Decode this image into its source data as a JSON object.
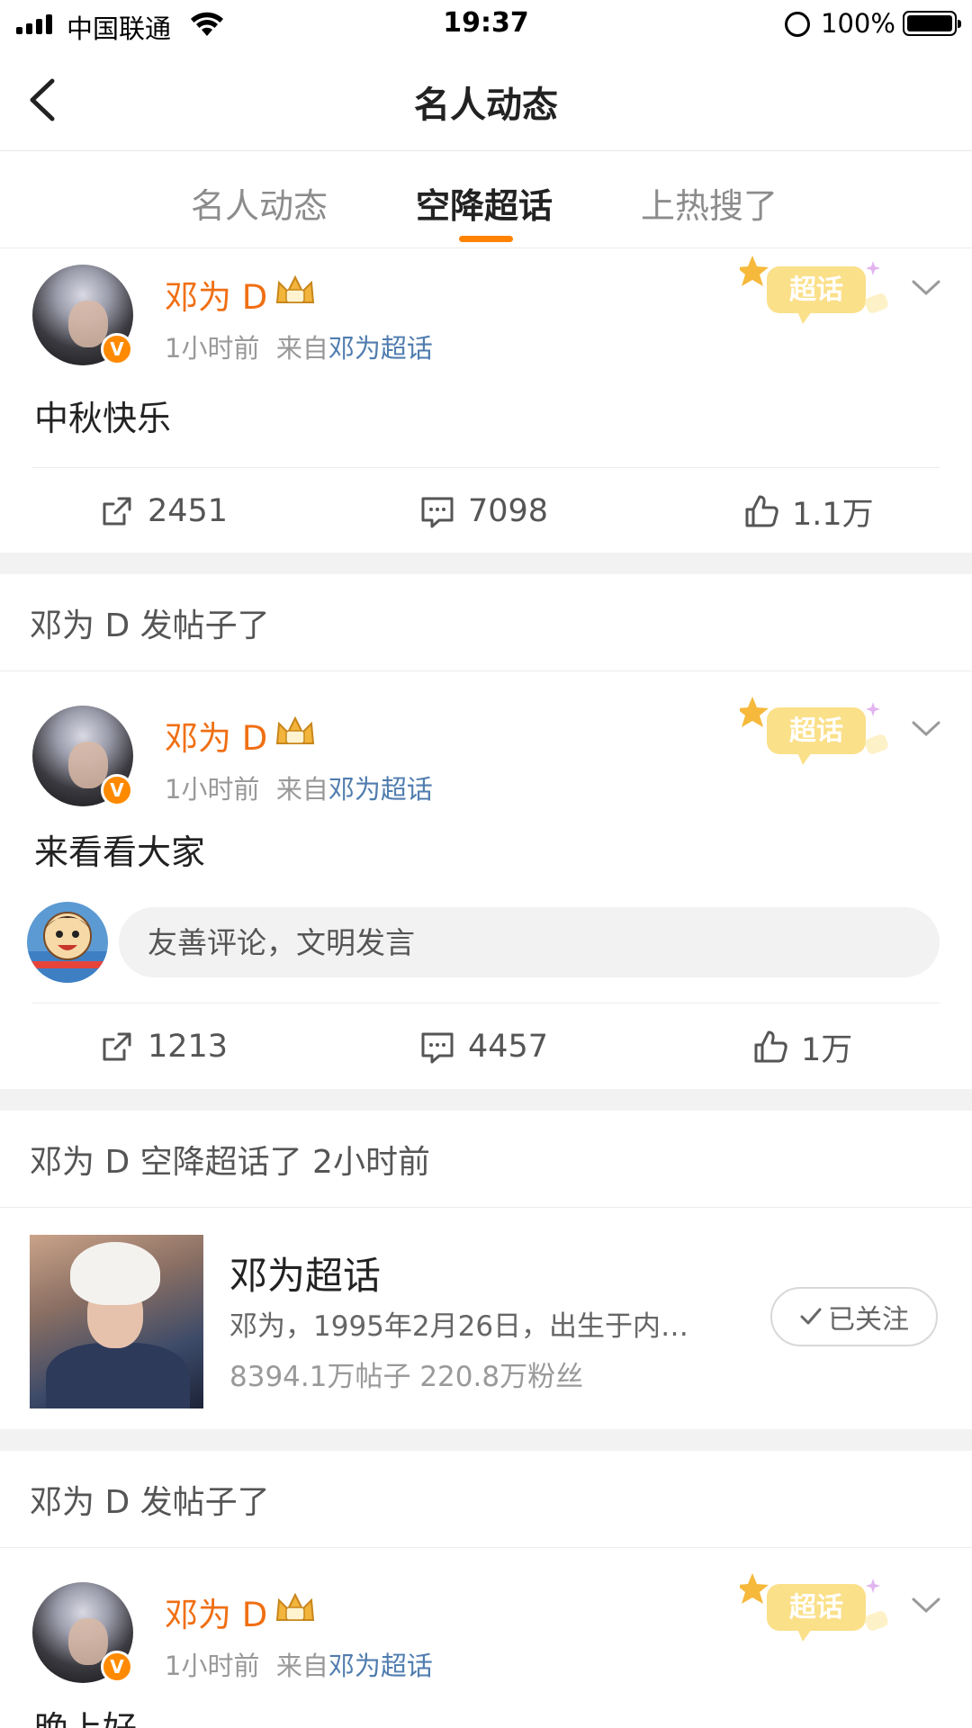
{
  "status_bar": {
    "carrier": "中国联通",
    "time": "19:37",
    "battery_percent": "100%"
  },
  "nav": {
    "title": "名人动态"
  },
  "tabs": [
    {
      "label": "名人动态",
      "active": false
    },
    {
      "label": "空降超话",
      "active": true
    },
    {
      "label": "上热搜了",
      "active": false
    }
  ],
  "colors": {
    "accent": "#ff8200",
    "username": "#f06f14",
    "link": "#507daf"
  },
  "feed": {
    "post1": {
      "user_name": "邓为 D",
      "time": "1小时前",
      "source_prefix": "来自",
      "source_link": "邓为超话",
      "badge": "超话",
      "text": "中秋快乐",
      "reposts": "2451",
      "comments": "7098",
      "likes": "1.1万"
    },
    "section2": {
      "header": "邓为 D 发帖子了"
    },
    "post2": {
      "user_name": "邓为 D",
      "time": "1小时前",
      "source_prefix": "来自",
      "source_link": "邓为超话",
      "badge": "超话",
      "text": "来看看大家",
      "comment_placeholder": "友善评论，文明发言",
      "reposts": "1213",
      "comments": "4457",
      "likes": "1万"
    },
    "section3": {
      "header": "邓为 D 空降超话了 2小时前"
    },
    "topic": {
      "title": "邓为超话",
      "description": "邓为，1995年2月26日，出生于内…",
      "stats": "8394.1万帖子  220.8万粉丝",
      "follow_label": "已关注"
    },
    "section4": {
      "header": "邓为 D 发帖子了"
    },
    "post3": {
      "user_name": "邓为 D",
      "time": "1小时前",
      "source_prefix": "来自",
      "source_link": "邓为超话",
      "badge": "超话",
      "text": "晚上好"
    }
  },
  "icons": [
    "signal-icon",
    "wifi-icon",
    "orientation-lock-icon",
    "battery-icon",
    "back-arrow-icon",
    "crown-icon",
    "verified-icon",
    "repost-icon",
    "comment-icon",
    "like-icon",
    "chevron-down-icon",
    "checkmark-icon"
  ]
}
